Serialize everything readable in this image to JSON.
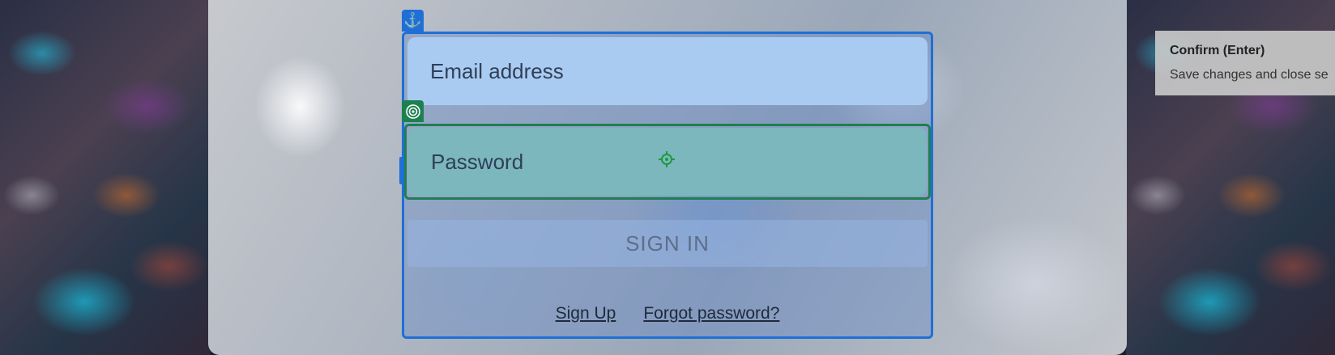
{
  "form": {
    "email_placeholder": "Email address",
    "password_placeholder": "Password",
    "signin_label": "SIGN IN",
    "signup_link": "Sign Up",
    "forgot_link": "Forgot password?"
  },
  "tooltip": {
    "title": "Confirm (Enter)",
    "description": "Save changes and close se"
  },
  "icons": {
    "anchor": "anchor-icon",
    "target": "target-icon",
    "crosshair": "crosshair-icon"
  },
  "colors": {
    "selection_blue": "#1f6fd6",
    "selection_green": "#1d8050",
    "email_bg": "#a9cbf2",
    "password_bg": "#7cb7be"
  }
}
